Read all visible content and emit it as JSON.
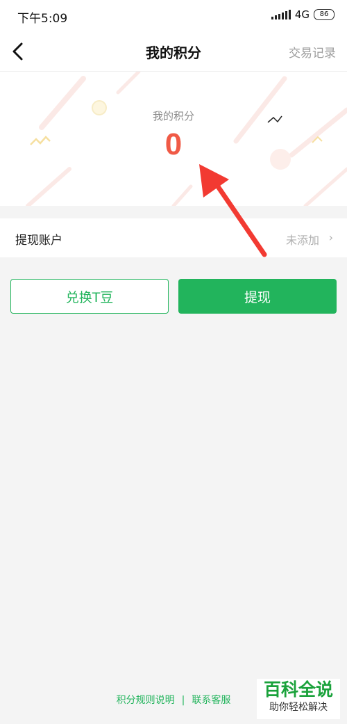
{
  "status_bar": {
    "time": "下午5:09",
    "network": "4G",
    "battery": "86"
  },
  "nav": {
    "title": "我的积分",
    "right_link": "交易记录"
  },
  "points": {
    "label": "我的积分",
    "value": "0"
  },
  "withdraw_account": {
    "label": "提现账户",
    "status": "未添加",
    "chevron": "›"
  },
  "actions": {
    "exchange_label": "兑换T豆",
    "withdraw_label": "提现"
  },
  "footer": {
    "rules_link": "积分规则说明",
    "separator": "|",
    "contact_link": "联系客服"
  },
  "watermark": {
    "main": "百科全说",
    "sub": "助你轻松解决"
  },
  "colors": {
    "accent_green": "#22b45c",
    "points_red": "#f05a46",
    "background": "#f4f4f4"
  }
}
